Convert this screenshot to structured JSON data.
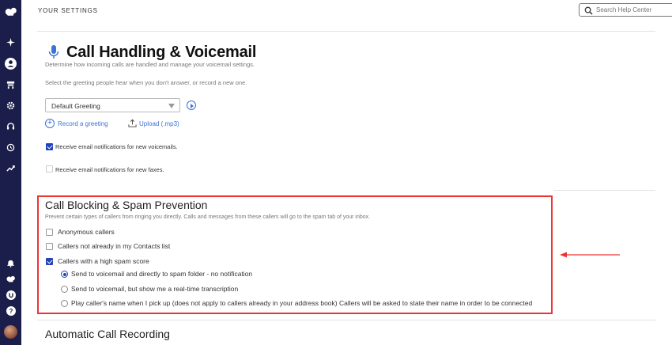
{
  "topbar": {
    "title": "YOUR SETTINGS",
    "search_placeholder": "Search Help Center"
  },
  "sidebar": {
    "items": [
      {
        "icon": "dialpad-logo-icon"
      },
      {
        "icon": "sparkle-icon"
      },
      {
        "icon": "person-icon"
      },
      {
        "icon": "office-icon"
      },
      {
        "icon": "gear-icon"
      },
      {
        "icon": "headset-icon"
      },
      {
        "icon": "history-icon"
      },
      {
        "icon": "trend-icon"
      },
      {
        "icon": "bell-icon"
      },
      {
        "icon": "dialpad-small-icon"
      },
      {
        "icon": "globe-icon"
      },
      {
        "icon": "help-icon"
      }
    ]
  },
  "call_handling": {
    "title": "Call Handling & Voicemail",
    "description": "Determine how incoming calls are handled and manage your voicemail settings.",
    "greeting_prompt": "Select the greeting people hear when you don't answer, or record a new one.",
    "greeting_selected": "Default Greeting",
    "record_label": "Record a greeting",
    "upload_label": "Upload (.mp3)",
    "email_voicemails": {
      "label": "Receive email notifications for new voicemails.",
      "checked": true
    },
    "email_faxes": {
      "label": "Receive email notifications for new faxes.",
      "checked": false
    }
  },
  "call_blocking": {
    "title": "Call Blocking & Spam Prevention",
    "description": "Prevent certain types of callers from ringing you directly. Calls and messages from these callers will go to the spam tab of your inbox.",
    "options": [
      {
        "label": "Anonymous callers",
        "checked": false
      },
      {
        "label": "Callers not already in my Contacts list",
        "checked": false
      },
      {
        "label": "Callers with a high spam score",
        "checked": true
      }
    ],
    "spam_actions": [
      {
        "label": "Send to voicemail and directly to spam folder - no notification",
        "selected": true
      },
      {
        "label": "Send to voicemail, but show me a real-time transcription",
        "selected": false
      },
      {
        "label": "Play caller's name when I pick up (does not apply to callers already in your address book) Callers will be asked to state their name in order to be connected",
        "selected": false
      }
    ]
  },
  "recording": {
    "title": "Automatic Call Recording"
  },
  "colors": {
    "sidebar": "#1b1d4a",
    "accent": "#3b73d6",
    "checkbox": "#2343b8",
    "highlight": "#ee3333"
  }
}
